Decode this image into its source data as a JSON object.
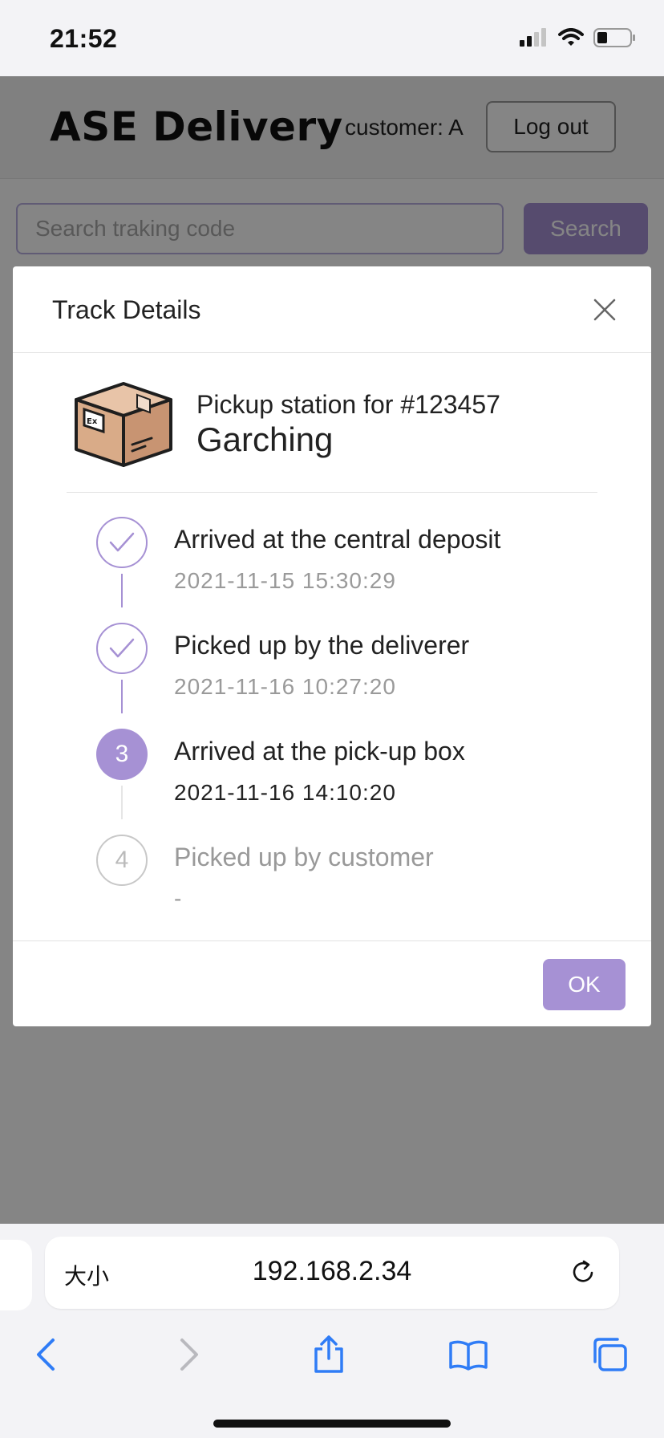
{
  "status_bar": {
    "time": "21:52",
    "icons": [
      "signal-icon",
      "wifi-icon",
      "battery-icon"
    ]
  },
  "navbar": {
    "brand": "ASE Delivery",
    "customer_label": "customer: A",
    "logout_label": "Log out"
  },
  "search": {
    "placeholder": "Search traking code",
    "button_label": "Search"
  },
  "modal": {
    "title": "Track Details",
    "close_icon": "close-icon",
    "package": {
      "icon": "package-box-icon",
      "caption": "Pickup station for #123457",
      "station": "Garching"
    },
    "steps": [
      {
        "status": "done",
        "marker": "",
        "title": "Arrived at the central deposit",
        "time": "2021-11-15 15:30:29"
      },
      {
        "status": "done",
        "marker": "",
        "title": "Picked up by the deliverer",
        "time": "2021-11-16 10:27:20"
      },
      {
        "status": "current",
        "marker": "3",
        "title": "Arrived at the pick-up box",
        "time": "2021-11-16 14:10:20"
      },
      {
        "status": "pending",
        "marker": "4",
        "title": "Picked up by customer",
        "time": "-"
      }
    ],
    "ok_label": "OK"
  },
  "safari": {
    "text_size_label": "大小",
    "url": "192.168.2.34",
    "toolbar_icons": [
      "back-icon",
      "forward-icon",
      "share-icon",
      "bookmarks-icon",
      "tabs-icon"
    ]
  },
  "colors": {
    "accent": "#a691d4",
    "overlay": "#7a7a7a"
  }
}
